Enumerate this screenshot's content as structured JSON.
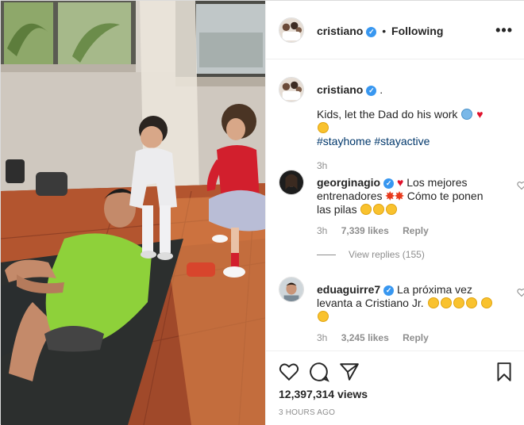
{
  "post": {
    "author": "cristiano",
    "follow_separator": "•",
    "follow_state": "Following",
    "more_label": "•••"
  },
  "caption": {
    "author": "cristiano",
    "trailing": ".",
    "text": "Kids, let the Dad do his work",
    "hashtags": [
      "#stayhome",
      "#stayactive"
    ],
    "time": "3h"
  },
  "comments": [
    {
      "author": "georginagio",
      "text_a": "Los mejores entrenadores",
      "text_b": "Cómo te ponen las pilas",
      "time": "3h",
      "likes": "7,339 likes",
      "reply": "Reply"
    },
    {
      "author": "eduaguirre7",
      "text": "La próxima vez levanta a Cristiano Jr.",
      "time": "3h",
      "likes": "3,245 likes",
      "reply": "Reply"
    }
  ],
  "view_replies": "View replies (155)",
  "footer": {
    "views": "12,397,314 views",
    "timestamp": "3 HOURS AGO"
  },
  "icons": {
    "verified": "verified-badge-icon",
    "like": "heart-outline-icon",
    "comment": "speech-bubble-icon",
    "share": "paper-plane-icon",
    "save": "bookmark-icon"
  },
  "colors": {
    "hashtag": "#00376b",
    "verified": "#3897f0",
    "muted": "#8e8e8e",
    "heart_emoji": "#e0112b"
  }
}
